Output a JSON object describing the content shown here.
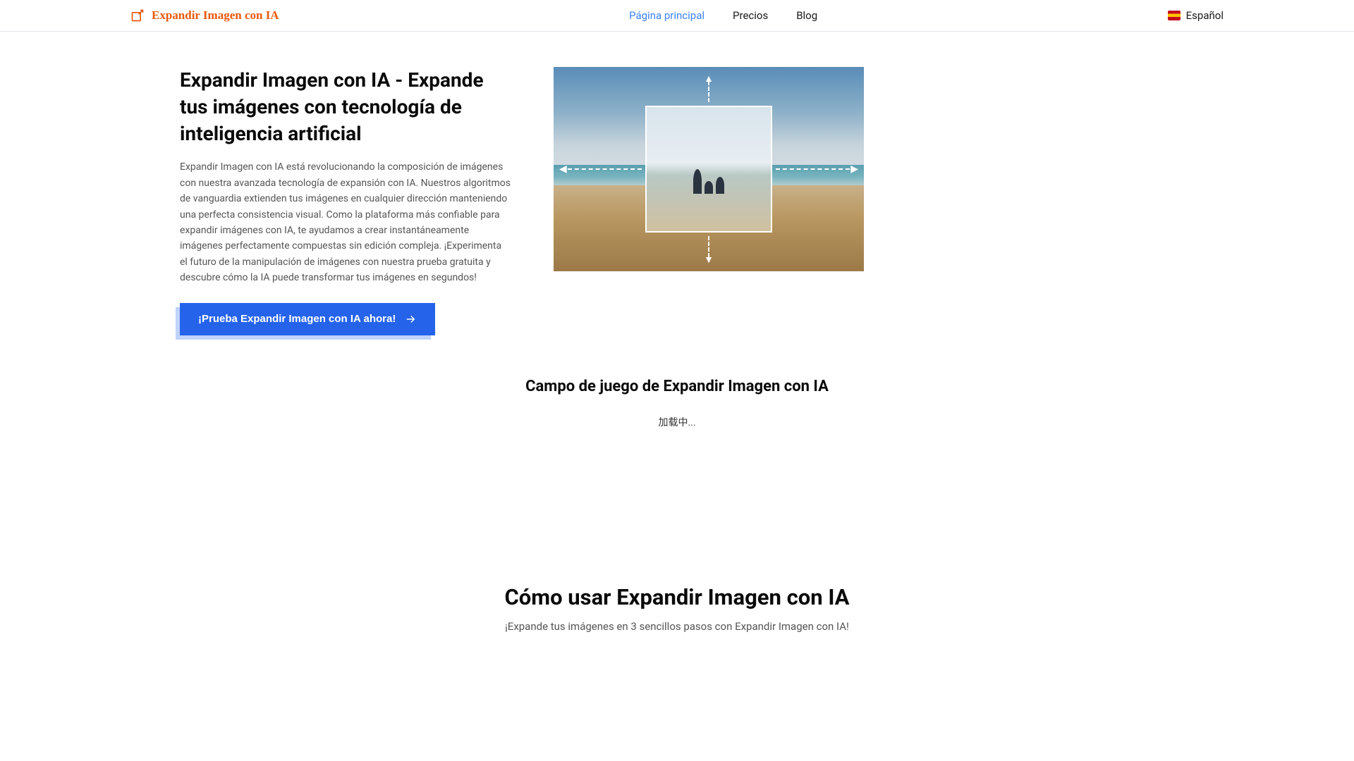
{
  "header": {
    "logo_text": "Expandir Imagen con IA",
    "nav": {
      "home": "Página principal",
      "pricing": "Precios",
      "blog": "Blog"
    },
    "language": "Español"
  },
  "hero": {
    "title": "Expandir Imagen con IA - Expande tus imágenes con tecnología de inteligencia artificial",
    "description": "Expandir Imagen con IA está revolucionando la composición de imágenes con nuestra avanzada tecnología de expansión con IA. Nuestros algoritmos de vanguardia extienden tus imágenes en cualquier dirección manteniendo una perfecta consistencia visual. Como la plataforma más confiable para expandir imágenes con IA, te ayudamos a crear instantáneamente imágenes perfectamente compuestas sin edición compleja. ¡Experimenta el futuro de la manipulación de imágenes con nuestra prueba gratuita y descubre cómo la IA puede transformar tus imágenes en segundos!",
    "cta_label": "¡Prueba Expandir Imagen con IA ahora!"
  },
  "playground": {
    "title": "Campo de juego de Expandir Imagen con IA",
    "loading": "加载中..."
  },
  "howto": {
    "title": "Cómo usar Expandir Imagen con IA",
    "subtitle": "¡Expande tus imágenes en 3 sencillos pasos con Expandir Imagen con IA!"
  }
}
